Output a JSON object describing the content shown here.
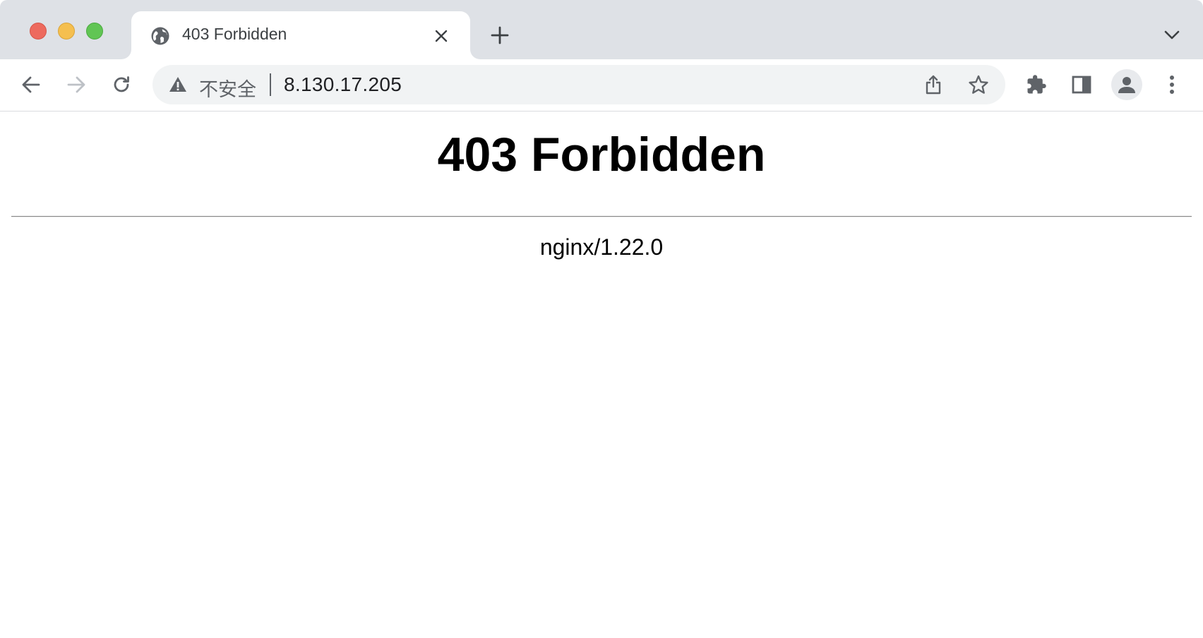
{
  "browser": {
    "tab": {
      "title": "403 Forbidden",
      "favicon": "globe-icon"
    },
    "omnibox": {
      "security_label": "不安全",
      "security_icon": "warning-icon",
      "url": "8.130.17.205"
    }
  },
  "page": {
    "heading": "403 Forbidden",
    "server_signature": "nginx/1.22.0"
  },
  "colors": {
    "tabstrip_bg": "#dee1e6",
    "omnibox_bg": "#f1f3f4",
    "icon_color": "#5f6368",
    "traffic_red": "#ed6a5e",
    "traffic_yellow": "#f5bf4f",
    "traffic_green": "#61c554"
  }
}
